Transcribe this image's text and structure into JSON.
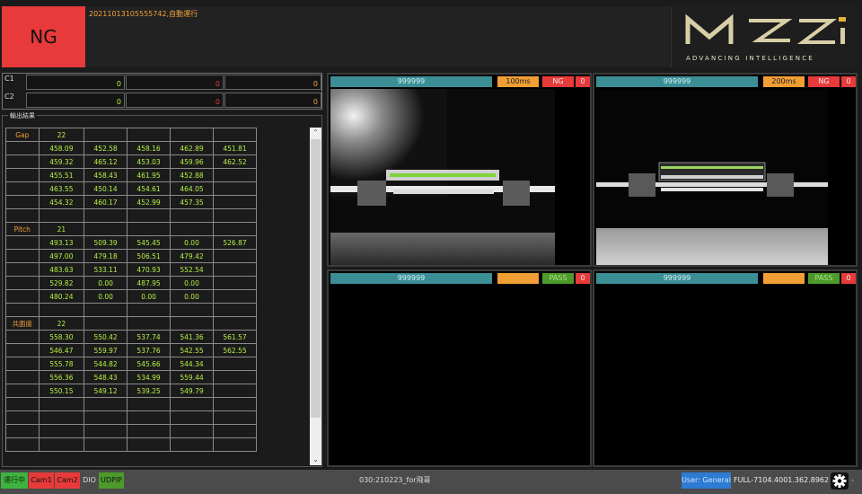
{
  "header": {
    "result_label": "NG",
    "status_text": "20211013105555742,自動運行",
    "logo_tagline": "ADVANCING INTELLIGENCE"
  },
  "counters": [
    {
      "label": "C1",
      "values": [
        "0",
        "0",
        "0"
      ]
    },
    {
      "label": "C2",
      "values": [
        "0",
        "0",
        "0"
      ]
    }
  ],
  "results": {
    "legend": "輸出結果",
    "rows": [
      [
        "Gap",
        "22",
        "",
        "",
        "",
        ""
      ],
      [
        "",
        "458.09",
        "452.58",
        "458.16",
        "462.89",
        "451.81"
      ],
      [
        "",
        "459.32",
        "465.12",
        "453.03",
        "459.96",
        "462.52"
      ],
      [
        "",
        "455.51",
        "458.43",
        "461.95",
        "452.88",
        ""
      ],
      [
        "",
        "463.55",
        "450.14",
        "454.61",
        "464.05",
        ""
      ],
      [
        "",
        "454.32",
        "460.17",
        "452.99",
        "457.35",
        ""
      ],
      [
        "",
        "",
        "",
        "",
        "",
        ""
      ],
      [
        "Pitch",
        "21",
        "",
        "",
        "",
        ""
      ],
      [
        "",
        "493.13",
        "509.39",
        "545.45",
        "0.00",
        "526.87"
      ],
      [
        "",
        "497.00",
        "479.18",
        "506.51",
        "479.42",
        ""
      ],
      [
        "",
        "483.63",
        "533.11",
        "470.93",
        "552.54",
        ""
      ],
      [
        "",
        "529.82",
        "0.00",
        "487.95",
        "0.00",
        ""
      ],
      [
        "",
        "480.24",
        "0.00",
        "0.00",
        "0.00",
        ""
      ],
      [
        "",
        "",
        "",
        "",
        "",
        ""
      ],
      [
        "共面度",
        "22",
        "",
        "",
        "",
        ""
      ],
      [
        "",
        "558.30",
        "550.42",
        "537.74",
        "541.36",
        "561.57"
      ],
      [
        "",
        "546.47",
        "559.97",
        "537.76",
        "542.55",
        "562.55"
      ],
      [
        "",
        "555.78",
        "544.82",
        "545.66",
        "544.34",
        ""
      ],
      [
        "",
        "556.36",
        "548.43",
        "534.99",
        "559.44",
        ""
      ],
      [
        "",
        "550.15",
        "549.12",
        "539.25",
        "549.79",
        ""
      ],
      [
        "",
        "",
        "",
        "",
        "",
        ""
      ],
      [
        "",
        "",
        "",
        "",
        "",
        ""
      ],
      [
        "",
        "",
        "",
        "",
        "",
        ""
      ],
      [
        "",
        "",
        "",
        "",
        "",
        ""
      ]
    ]
  },
  "cameras": [
    {
      "name": "999999",
      "time": "100ms",
      "result": "NG",
      "count": "0"
    },
    {
      "name": "999999",
      "time": "200ms",
      "result": "NG",
      "count": "0"
    },
    {
      "name": "999999",
      "time": "",
      "result": "PASS",
      "count": "0"
    },
    {
      "name": "999999",
      "time": "",
      "result": "PASS",
      "count": "0"
    }
  ],
  "footer": {
    "badges": [
      {
        "label": "運行中",
        "bg": "#3fb33f",
        "fg": "#0b2a0b"
      },
      {
        "label": "Cam1",
        "bg": "#e83a3a",
        "fg": "#111111"
      },
      {
        "label": "Cam2",
        "bg": "#e83a3a",
        "fg": "#111111"
      },
      {
        "label": "DIO",
        "bg": "#4b4b4b",
        "fg": "#dddddd"
      },
      {
        "label": "UDPIP",
        "bg": "#4d9a2a",
        "fg": "#111111"
      }
    ],
    "file_label": "030:210223_for飛哥",
    "user_label": "User: General",
    "version_label": "FULL-7104.4001.362.8962",
    "dash": "-"
  },
  "colors": {
    "ng_red": "#e83a3a",
    "pass_green": "#4d9a2a",
    "accent_orange": "#f19e35",
    "teal": "#3b8e96",
    "value_green": "#b5f046"
  }
}
